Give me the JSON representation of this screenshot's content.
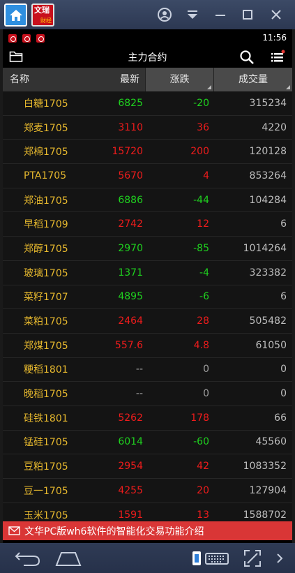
{
  "statusbar": {
    "time": "11:56"
  },
  "appbar": {
    "title": "主力合约"
  },
  "table": {
    "headers": {
      "name": "名称",
      "price": "最新",
      "change": "涨跌",
      "volume": "成交量"
    },
    "rows": [
      {
        "name": "白糖1705",
        "price": "6825",
        "change": "-20",
        "volume": "315234",
        "dir": "down",
        "price_dir": "down"
      },
      {
        "name": "郑麦1705",
        "price": "3110",
        "change": "36",
        "volume": "4220",
        "dir": "up",
        "price_dir": "up"
      },
      {
        "name": "郑棉1705",
        "price": "15720",
        "change": "200",
        "volume": "120128",
        "dir": "up",
        "price_dir": "up"
      },
      {
        "name": "PTA1705",
        "price": "5670",
        "change": "4",
        "volume": "853264",
        "dir": "up",
        "price_dir": "up"
      },
      {
        "name": "郑油1705",
        "price": "6886",
        "change": "-44",
        "volume": "104284",
        "dir": "down",
        "price_dir": "down"
      },
      {
        "name": "早稻1709",
        "price": "2742",
        "change": "12",
        "volume": "6",
        "dir": "up",
        "price_dir": "up"
      },
      {
        "name": "郑醇1705",
        "price": "2970",
        "change": "-85",
        "volume": "1014264",
        "dir": "down",
        "price_dir": "down"
      },
      {
        "name": "玻璃1705",
        "price": "1371",
        "change": "-4",
        "volume": "323382",
        "dir": "down",
        "price_dir": "down"
      },
      {
        "name": "菜籽1707",
        "price": "4895",
        "change": "-6",
        "volume": "6",
        "dir": "down",
        "price_dir": "down"
      },
      {
        "name": "菜粕1705",
        "price": "2464",
        "change": "28",
        "volume": "505482",
        "dir": "up",
        "price_dir": "up"
      },
      {
        "name": "郑煤1705",
        "price": "557.6",
        "change": "4.8",
        "volume": "61050",
        "dir": "up",
        "price_dir": "up"
      },
      {
        "name": "粳稻1801",
        "price": "--",
        "change": "0",
        "volume": "0",
        "dir": "flat",
        "price_dir": "flat"
      },
      {
        "name": "晚稻1705",
        "price": "--",
        "change": "0",
        "volume": "0",
        "dir": "flat",
        "price_dir": "flat"
      },
      {
        "name": "硅铁1801",
        "price": "5262",
        "change": "178",
        "volume": "66",
        "dir": "up",
        "price_dir": "up"
      },
      {
        "name": "锰硅1705",
        "price": "6014",
        "change": "-60",
        "volume": "45560",
        "dir": "down",
        "price_dir": "down"
      },
      {
        "name": "豆粕1705",
        "price": "2954",
        "change": "42",
        "volume": "1083352",
        "dir": "up",
        "price_dir": "up"
      },
      {
        "name": "豆一1705",
        "price": "4255",
        "change": "20",
        "volume": "127904",
        "dir": "up",
        "price_dir": "up"
      },
      {
        "name": "玉米1705",
        "price": "1591",
        "change": "13",
        "volume": "1588702",
        "dir": "up",
        "price_dir": "up"
      }
    ]
  },
  "banner": {
    "text": "文华PC版wh6软件的智能化交易功能介绍"
  },
  "host": {
    "app_tile_text_top": "文瑞",
    "app_tile_text_bottom": "财经"
  },
  "colors": {
    "up": "#ee1c1c",
    "down": "#1fd11f",
    "name": "#e6b82e",
    "banner": "#d93636"
  },
  "icons": [
    "home-icon",
    "user-circle-icon",
    "download-icon",
    "minimize-icon",
    "maximize-icon",
    "close-icon",
    "folder-icon",
    "search-icon",
    "list-menu-icon",
    "mail-icon",
    "back-icon",
    "home-nav-icon",
    "keyboard-icon",
    "fullscreen-icon",
    "chevron-right-icon"
  ]
}
